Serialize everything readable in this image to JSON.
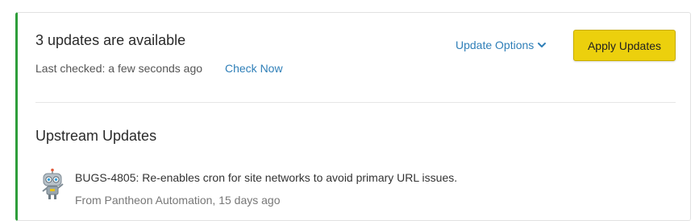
{
  "header": {
    "title": "3 updates are available",
    "last_checked": "Last checked: a few seconds ago",
    "check_now": "Check Now",
    "update_options": "Update Options",
    "apply_updates": "Apply Updates"
  },
  "upstream": {
    "title": "Upstream Updates",
    "items": [
      {
        "message": "BUGS-4805: Re-enables cron for site networks to avoid primary URL issues.",
        "meta": "From Pantheon Automation, 15 days ago",
        "avatar_icon": "robot-avatar-icon"
      }
    ]
  },
  "colors": {
    "accent_green": "#2e9e3a",
    "link_blue": "#2f7fb8",
    "button_yellow": "#ecd00d"
  }
}
